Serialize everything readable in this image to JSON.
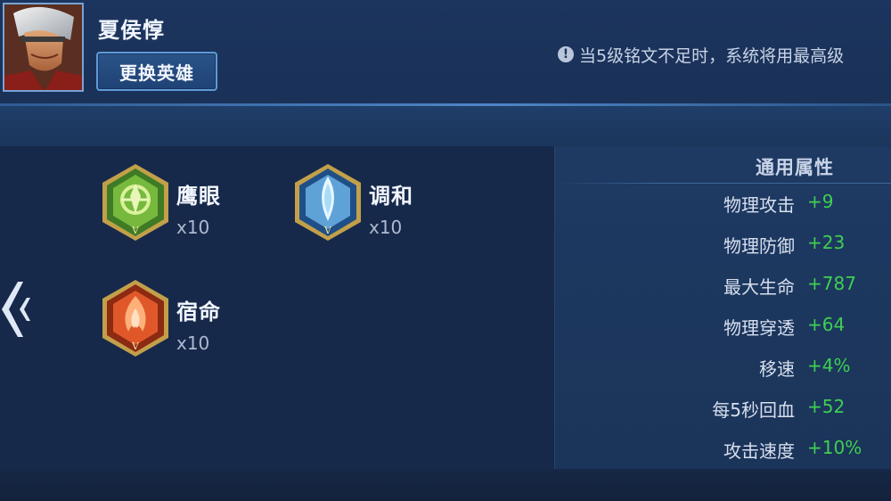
{
  "hero": {
    "name": "夏侯惇",
    "change_button": "更换英雄"
  },
  "notice": {
    "icon": "info-icon",
    "text": "当5级铭文不足时，系统将用最高级"
  },
  "runes": [
    {
      "name": "鹰眼",
      "count": "x10",
      "icon": "green-rune-icon",
      "color": "#4f9a35"
    },
    {
      "name": "调和",
      "count": "x10",
      "icon": "blue-rune-icon",
      "color": "#3d78b4"
    },
    {
      "name": "宿命",
      "count": "x10",
      "icon": "red-rune-icon",
      "color": "#c8461d"
    }
  ],
  "stats": {
    "title": "通用属性",
    "rows": [
      {
        "label": "物理攻击",
        "value": "+9"
      },
      {
        "label": "物理防御",
        "value": "+23"
      },
      {
        "label": "最大生命",
        "value": "+787"
      },
      {
        "label": "物理穿透",
        "value": "+64"
      },
      {
        "label": "移速",
        "value": "+4%"
      },
      {
        "label": "每5秒回血",
        "value": "+52"
      },
      {
        "label": "攻击速度",
        "value": "+10%"
      }
    ]
  },
  "colors": {
    "background": "#17294a",
    "accent": "#5f9ad6",
    "stat_value": "#3ecf52"
  }
}
